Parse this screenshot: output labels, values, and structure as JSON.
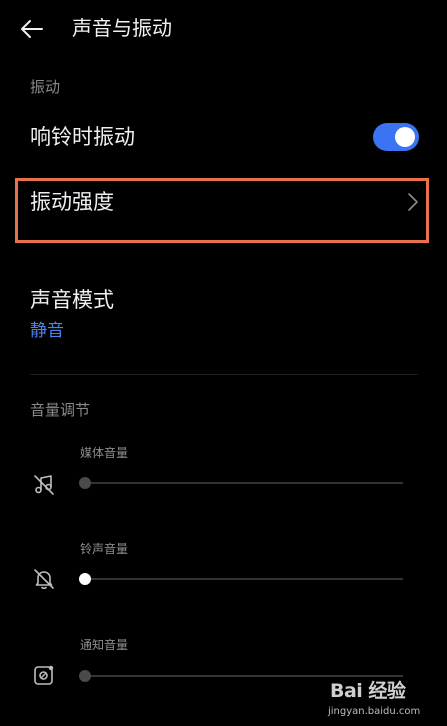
{
  "header": {
    "title": "声音与振动",
    "back_icon": "arrow-left-icon"
  },
  "vibration_section": {
    "label": "振动",
    "ring_vibrate": {
      "label": "响铃时振动",
      "enabled": true
    },
    "intensity": {
      "label": "振动强度"
    }
  },
  "sound_mode": {
    "label": "声音模式",
    "value": "静音"
  },
  "volume_section": {
    "label": "音量调节",
    "sliders": [
      {
        "label": "媒体音量",
        "icon": "music-muted-icon",
        "level": 0,
        "enabled": false
      },
      {
        "label": "铃声音量",
        "icon": "bell-muted-icon",
        "level": 0,
        "enabled": true
      },
      {
        "label": "通知音量",
        "icon": "notification-icon",
        "level": 0,
        "enabled": false
      }
    ]
  },
  "watermark": {
    "brand": "Bai 经验",
    "url": "jingyan.baidu.com"
  },
  "colors": {
    "background": "#000000",
    "accent": "#3a74f2",
    "highlight": "#e8704a",
    "link": "#4d82f0"
  }
}
